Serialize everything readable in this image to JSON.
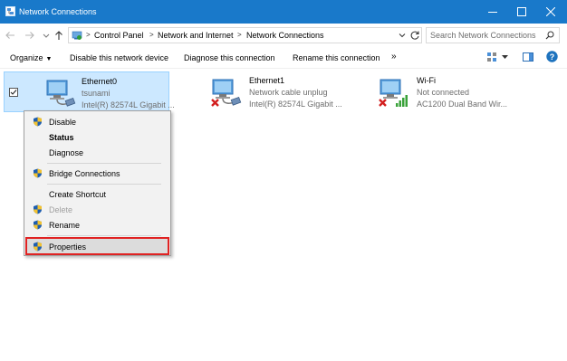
{
  "window": {
    "title": "Network Connections",
    "title_bar_color": "#1979ca"
  },
  "address_bar": {
    "breadcrumbs": [
      "Control Panel",
      "Network and Internet",
      "Network Connections"
    ],
    "search_placeholder": "Search Network Connections"
  },
  "command_bar": {
    "organize": "Organize",
    "disable": "Disable this network device",
    "diagnose": "Diagnose this connection",
    "rename": "Rename this connection",
    "more": "»"
  },
  "connections": [
    {
      "name": "Ethernet0",
      "status": "tsunami",
      "adapter": "Intel(R) 82574L Gigabit ...",
      "icon": "ethernet-icon",
      "selected": true
    },
    {
      "name": "Ethernet1",
      "status": "Network cable unplug",
      "adapter": "Intel(R) 82574L Gigabit ...",
      "icon": "ethernet-disconnected-icon",
      "selected": false
    },
    {
      "name": "Wi-Fi",
      "status": "Not connected",
      "adapter": "AC1200  Dual Band Wir...",
      "icon": "wifi-disconnected-icon",
      "selected": false
    }
  ],
  "context_menu": {
    "items": [
      {
        "label": "Disable",
        "icon": "shield-icon"
      },
      {
        "label": "Status",
        "icon": ""
      },
      {
        "label": "Diagnose",
        "icon": ""
      },
      {
        "label": "Bridge Connections",
        "icon": "shield-icon"
      },
      {
        "label": "Create Shortcut",
        "icon": ""
      },
      {
        "label": "Delete",
        "icon": "shield-icon"
      },
      {
        "label": "Rename",
        "icon": "shield-icon"
      },
      {
        "label": "Properties",
        "icon": "shield-icon"
      }
    ],
    "highlight_color": "#e02323"
  }
}
